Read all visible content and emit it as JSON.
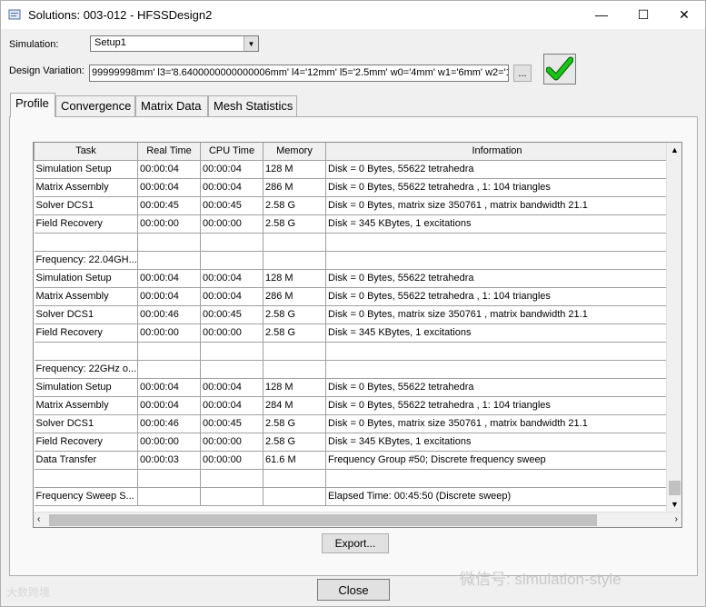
{
  "window": {
    "title": "Solutions: 003-012 - HFSSDesign2",
    "min_glyph": "—",
    "max_glyph": "☐",
    "close_glyph": "✕"
  },
  "simulation": {
    "label": "Simulation:",
    "value": "Setup1"
  },
  "design_variation": {
    "label": "Design Variation:",
    "value": "99999998mm' l3='8.6400000000000006mm' l4='12mm' l5='2.5mm' w0='4mm' w1='6mm' w2='1mm'",
    "browse_label": "..."
  },
  "status_icon": "green-checkmark-icon",
  "tabs": [
    {
      "label": "Profile",
      "active": true
    },
    {
      "label": "Convergence",
      "active": false
    },
    {
      "label": "Matrix Data",
      "active": false
    },
    {
      "label": "Mesh Statistics",
      "active": false
    }
  ],
  "table": {
    "columns": [
      "Task",
      "Real Time",
      "CPU Time",
      "Memory",
      "Information"
    ],
    "rows": [
      [
        "Simulation Setup",
        "00:00:04",
        "00:00:04",
        "128 M",
        "Disk = 0 Bytes, 55622 tetrahedra"
      ],
      [
        "Matrix Assembly",
        "00:00:04",
        "00:00:04",
        "286 M",
        "Disk = 0 Bytes, 55622 tetrahedra , 1: 104 triangles"
      ],
      [
        "Solver DCS1",
        "00:00:45",
        "00:00:45",
        "2.58 G",
        "Disk = 0 Bytes, matrix size 350761 , matrix bandwidth  21.1"
      ],
      [
        "Field Recovery",
        "00:00:00",
        "00:00:00",
        "2.58 G",
        "Disk = 345 KBytes, 1 excitations"
      ],
      [
        "",
        "",
        "",
        "",
        ""
      ],
      [
        "Frequency: 22.04GH...",
        "",
        "",
        "",
        ""
      ],
      [
        "Simulation Setup",
        "00:00:04",
        "00:00:04",
        "128 M",
        "Disk = 0 Bytes, 55622 tetrahedra"
      ],
      [
        "Matrix Assembly",
        "00:00:04",
        "00:00:04",
        "286 M",
        "Disk = 0 Bytes, 55622 tetrahedra , 1: 104 triangles"
      ],
      [
        "Solver DCS1",
        "00:00:46",
        "00:00:45",
        "2.58 G",
        "Disk = 0 Bytes, matrix size 350761 , matrix bandwidth  21.1"
      ],
      [
        "Field Recovery",
        "00:00:00",
        "00:00:00",
        "2.58 G",
        "Disk = 345 KBytes, 1 excitations"
      ],
      [
        "",
        "",
        "",
        "",
        ""
      ],
      [
        "Frequency: 22GHz o...",
        "",
        "",
        "",
        ""
      ],
      [
        "Simulation Setup",
        "00:00:04",
        "00:00:04",
        "128 M",
        "Disk = 0 Bytes, 55622 tetrahedra"
      ],
      [
        "Matrix Assembly",
        "00:00:04",
        "00:00:04",
        "284 M",
        "Disk = 0 Bytes, 55622 tetrahedra , 1: 104 triangles"
      ],
      [
        "Solver DCS1",
        "00:00:46",
        "00:00:45",
        "2.58 G",
        "Disk = 0 Bytes, matrix size 350761 , matrix bandwidth  21.1"
      ],
      [
        "Field Recovery",
        "00:00:00",
        "00:00:00",
        "2.58 G",
        "Disk = 345 KBytes, 1 excitations"
      ],
      [
        "Data Transfer",
        "00:00:03",
        "00:00:00",
        "61.6 M",
        "Frequency Group #50; Discrete frequency sweep"
      ],
      [
        "",
        "",
        "",
        "",
        ""
      ],
      [
        "Frequency Sweep S...",
        "",
        "",
        "",
        "Elapsed Time: 00:45:50 (Discrete sweep)"
      ]
    ]
  },
  "buttons": {
    "export": "Export...",
    "close": "Close"
  },
  "watermarks": {
    "left": "大数跨境",
    "right": "微信号: simulation-style"
  },
  "colors": {
    "check_green": "#19c419",
    "check_outline": "#0a6e0a"
  }
}
